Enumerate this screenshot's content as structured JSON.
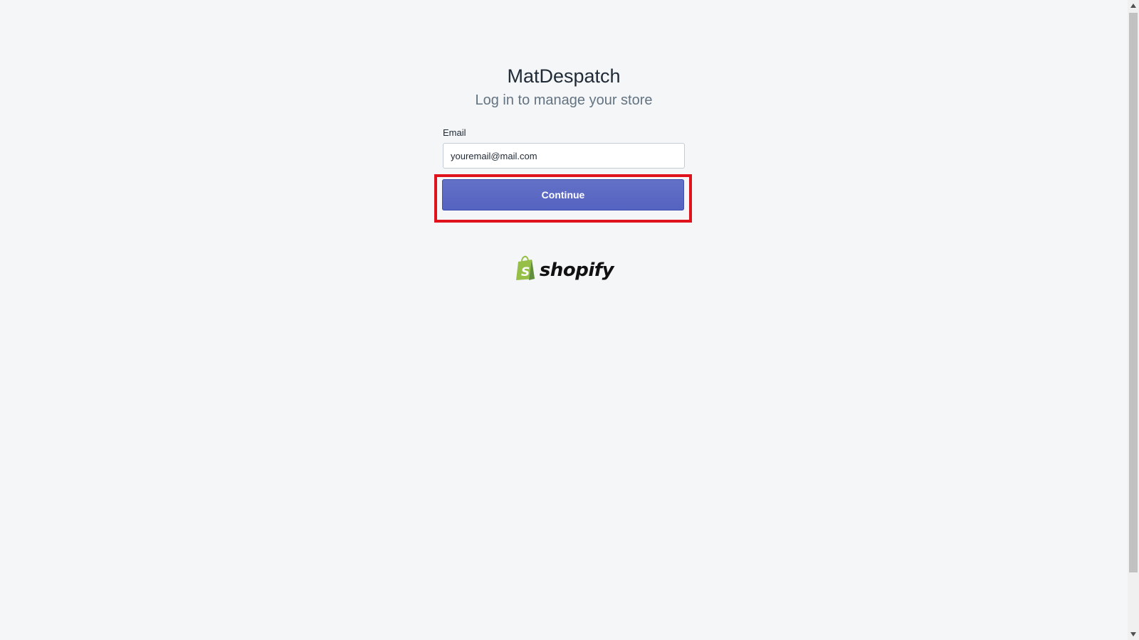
{
  "app": {
    "store_name": "MatDespatch",
    "subtitle": "Log in to manage your store"
  },
  "form": {
    "email_label": "Email",
    "email_value": "youremail@mail.com",
    "continue_label": "Continue"
  },
  "branding": {
    "logo_text": "shopify",
    "logo_icon": "shopify-bag-icon",
    "logo_color": "#95bf47"
  },
  "colors": {
    "button": "#5c6ac4",
    "highlight": "#e0131d",
    "background": "#f5f6f8"
  }
}
